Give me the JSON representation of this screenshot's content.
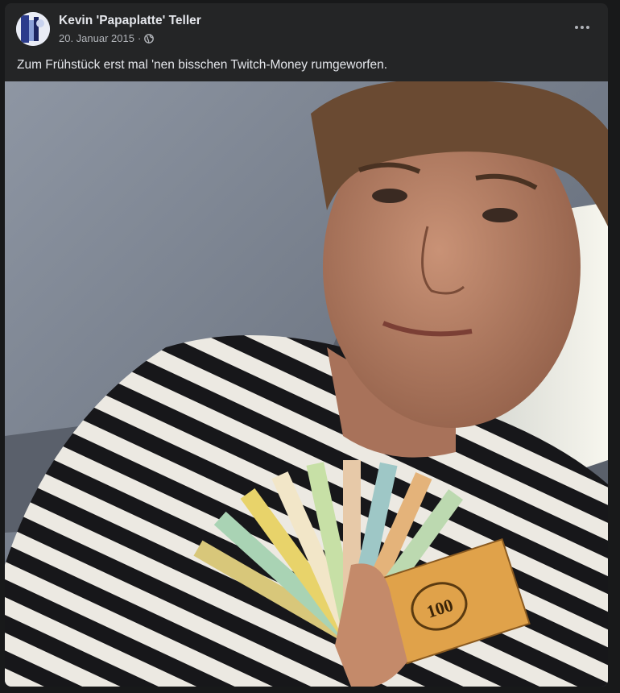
{
  "post": {
    "author": "Kevin 'Papaplatte' Teller",
    "date": "20. Januar 2015",
    "separator": "·",
    "audience_icon": "globe-icon",
    "more_icon": "more-options-icon",
    "caption": "Zum Frühstück erst mal 'nen bisschen Twitch-Money rumgeworfen."
  },
  "photo": {
    "money_label": "100"
  },
  "colors": {
    "background": "#18191a",
    "card": "#242526",
    "text_primary": "#e4e6eb",
    "text_secondary": "#b0b3b8"
  }
}
